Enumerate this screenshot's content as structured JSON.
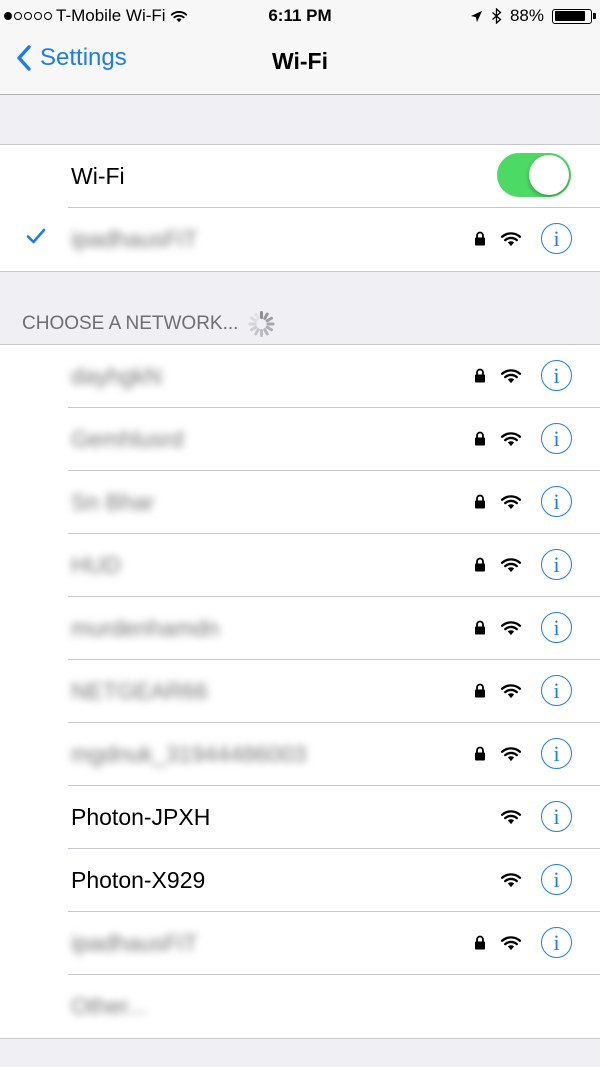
{
  "status": {
    "carrier": "T-Mobile Wi-Fi",
    "time": "6:11 PM",
    "battery": "88%",
    "signal_bars_filled": 1,
    "signal_bars_total": 5
  },
  "nav": {
    "back_label": "Settings",
    "title": "Wi-Fi"
  },
  "wifi_toggle": {
    "label": "Wi-Fi",
    "on": true
  },
  "connected": {
    "name": "ipadhausFiT",
    "secured": true
  },
  "section_header": "CHOOSE A NETWORK...",
  "networks": [
    {
      "name": "dayhgkN",
      "secured": true,
      "blurred": true
    },
    {
      "name": "Gemhlusrd",
      "secured": true,
      "blurred": true
    },
    {
      "name": "Sn Bhar",
      "secured": true,
      "blurred": true
    },
    {
      "name": "HUD",
      "secured": true,
      "blurred": true
    },
    {
      "name": "murdenhamdn",
      "secured": true,
      "blurred": true
    },
    {
      "name": "NETGEAR66",
      "secured": true,
      "blurred": true
    },
    {
      "name": "mgdnuk_31944486003",
      "secured": true,
      "blurred": true
    },
    {
      "name": "Photon-JPXH",
      "secured": false,
      "blurred": false
    },
    {
      "name": "Photon-X929",
      "secured": false,
      "blurred": false
    },
    {
      "name": "ipadhausFiT",
      "secured": true,
      "blurred": true
    },
    {
      "name": "Other...",
      "secured": false,
      "blurred": true,
      "other": true
    }
  ],
  "icons": {
    "info": "i",
    "accent": "#1a7cf3",
    "toggle_on": "#4cd964"
  }
}
